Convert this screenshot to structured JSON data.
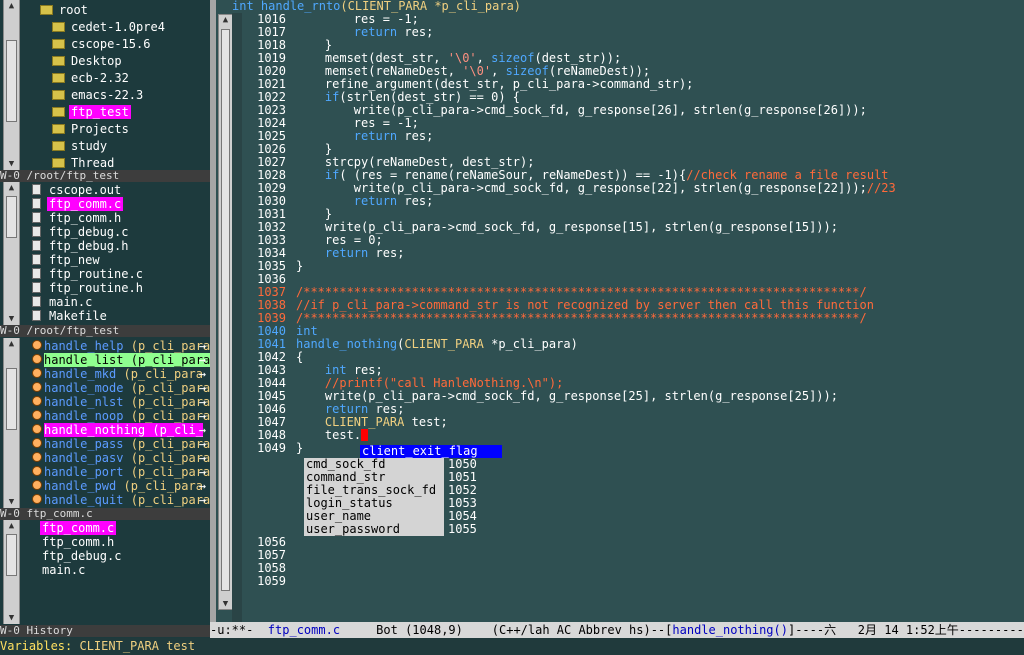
{
  "dir_tree": {
    "items": [
      {
        "label": "root",
        "selected": false
      },
      {
        "label": "cedet-1.0pre4",
        "selected": false
      },
      {
        "label": "cscope-15.6",
        "selected": false
      },
      {
        "label": "Desktop",
        "selected": false
      },
      {
        "label": "ecb-2.32",
        "selected": false
      },
      {
        "label": "emacs-22.3",
        "selected": false
      },
      {
        "label": "ftp_test",
        "selected": true
      },
      {
        "label": "Projects",
        "selected": false
      },
      {
        "label": "study",
        "selected": false
      },
      {
        "label": "Thread",
        "selected": false
      }
    ]
  },
  "sources": {
    "header": "W-0 /root/ftp_test",
    "items": [
      "cscope.out",
      "ftp_comm.c",
      "ftp_comm.h",
      "ftp_debug.c",
      "ftp_debug.h",
      "ftp_new",
      "ftp_routine.c",
      "ftp_routine.h",
      "main.c",
      "Makefile"
    ],
    "selected_index": 1
  },
  "methods": {
    "header": "W-0 /root/ftp_test",
    "items": [
      {
        "name": "handle_help",
        "args": "(p_cli_para"
      },
      {
        "name": "handle_list",
        "args": "(p_cli_para"
      },
      {
        "name": "handle_mkd",
        "args": "(p_cli_para"
      },
      {
        "name": "handle_mode",
        "args": "(p_cli_para"
      },
      {
        "name": "handle_nlst",
        "args": "(p_cli_para"
      },
      {
        "name": "handle_noop",
        "args": "(p_cli_para"
      },
      {
        "name": "handle_nothing",
        "args": "(p_cli_"
      },
      {
        "name": "handle_pass",
        "args": "(p_cli_para"
      },
      {
        "name": "handle_pasv",
        "args": "(p_cli_para"
      },
      {
        "name": "handle_port",
        "args": "(p_cli_para"
      },
      {
        "name": "handle_pwd",
        "args": "(p_cli_para"
      },
      {
        "name": "handle_quit",
        "args": "(p_cli_para"
      }
    ]
  },
  "history": {
    "header": "W-0 ftp_comm.c",
    "items": [
      "ftp_comm.c",
      "ftp_comm.h",
      "ftp_debug.c",
      "main.c"
    ],
    "footer": "W-0 History"
  },
  "editor": {
    "title_type": "int",
    "title_func": "handle_rnto",
    "title_args": "(CLIENT_PARA *p_cli_para)",
    "lines": [
      {
        "n": "1016",
        "t": "        res = -1;"
      },
      {
        "n": "1017",
        "t": "        return res;"
      },
      {
        "n": "1018",
        "t": "    }"
      },
      {
        "n": "1019",
        "t": "    memset(dest_str, '\\0', sizeof(dest_str));"
      },
      {
        "n": "1020",
        "t": "    memset(reNameDest, '\\0', sizeof(reNameDest));"
      },
      {
        "n": "1021",
        "t": "    refine_argument(dest_str, p_cli_para->command_str);"
      },
      {
        "n": "1022",
        "t": "    if(strlen(dest_str) == 0) {"
      },
      {
        "n": "1023",
        "t": "        write(p_cli_para->cmd_sock_fd, g_response[26], strlen(g_response[26]));"
      },
      {
        "n": "1024",
        "t": "        res = -1;"
      },
      {
        "n": "1025",
        "t": "        return res;"
      },
      {
        "n": "1026",
        "t": "    }"
      },
      {
        "n": "1027",
        "t": "    strcpy(reNameDest, dest_str);"
      },
      {
        "n": "1028",
        "t": "    if( (res = rename(reNameSour, reNameDest)) == -1){//check rename a file result"
      },
      {
        "n": "1029",
        "t": "        write(p_cli_para->cmd_sock_fd, g_response[22], strlen(g_response[22]));//23"
      },
      {
        "n": "1030",
        "t": "        return res;"
      },
      {
        "n": "1031",
        "t": "    }"
      },
      {
        "n": "1032",
        "t": "    write(p_cli_para->cmd_sock_fd, g_response[15], strlen(g_response[15]));"
      },
      {
        "n": "1033",
        "t": "    res = 0;"
      },
      {
        "n": "1034",
        "t": "    return res;"
      },
      {
        "n": "1035",
        "t": "}"
      },
      {
        "n": "1036",
        "t": ""
      },
      {
        "n": "1037",
        "t": "/*****************************************************************************/"
      },
      {
        "n": "1038",
        "t": "//if p_cli_para->command_str is not recognized by server then call this function"
      },
      {
        "n": "1039",
        "t": "/*****************************************************************************/"
      },
      {
        "n": "1040",
        "t": "int"
      },
      {
        "n": "1041",
        "t": "handle_nothing(CLIENT_PARA *p_cli_para)"
      },
      {
        "n": "1042",
        "t": "{"
      },
      {
        "n": "1043",
        "t": "    int res;"
      },
      {
        "n": "1044",
        "t": "    //printf(\"call HanleNothing.\\n\");"
      },
      {
        "n": "1045",
        "t": "    write(p_cli_para->cmd_sock_fd, g_response[25], strlen(g_response[25]));"
      },
      {
        "n": "1046",
        "t": "    return res;"
      },
      {
        "n": "1047",
        "t": "    CLIENT_PARA test;"
      },
      {
        "n": "1048",
        "t": "    test."
      },
      {
        "n": "1049",
        "t": "}"
      }
    ],
    "completion_selected": "client_exit_flag",
    "completion_items": [
      "cmd_sock_fd",
      "command_str",
      "file_trans_sock_fd",
      "login_status",
      "user_name",
      "user_password"
    ],
    "hidden_line_numbers": [
      "1050",
      "1051",
      "1052",
      "1053",
      "1054",
      "1055"
    ],
    "tail_lines": [
      "1056",
      "1057",
      "1058",
      "1059"
    ]
  },
  "modeline": {
    "prefix": "-u:**-  ",
    "filename": "ftp_comm.c",
    "position": "     Bot (1048,9)    (C++/lah AC Abbrev hs)--[",
    "func": "handle_nothing()",
    "suffix": "]----六   2月 14 1:52上午-----------"
  },
  "minibuffer": {
    "label": "Variables: ",
    "type": "CLIENT_PARA",
    "name": " test"
  },
  "colors": {
    "background": "#1d3a3d",
    "editor_bg": "#2f5052",
    "selected_magenta": "#ff00ff",
    "keyword_blue": "#4fa8ff",
    "string_red": "#ff9080",
    "comment_orange": "#ff6a3a",
    "type_yellow": "#f0d080"
  }
}
